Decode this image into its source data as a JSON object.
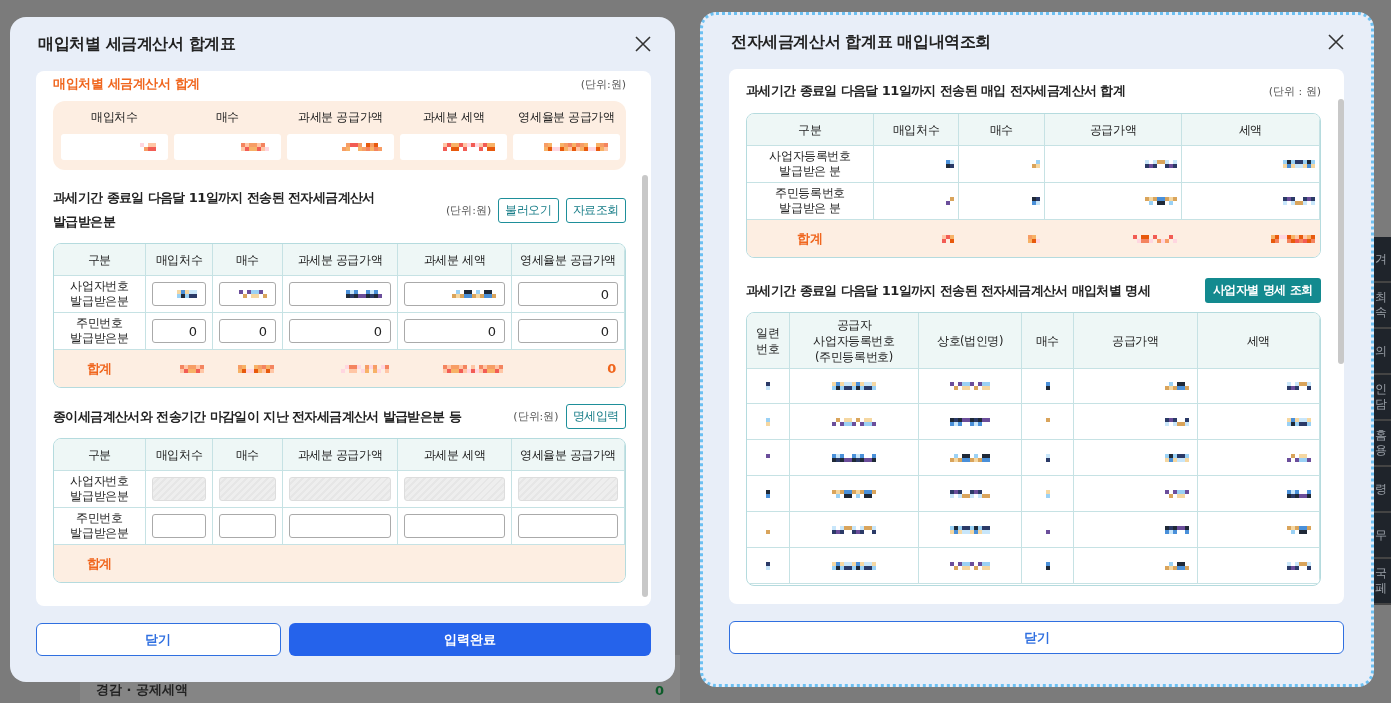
{
  "page": {
    "background_label": "경감 · 공제세액",
    "background_value": "0",
    "side_menu": [
      "겨",
      "최\n속",
      "의",
      "인\n담",
      "홈\n용",
      "령",
      "무",
      "국\n페"
    ]
  },
  "left": {
    "title": "매입처별 세금계산서 합계표",
    "summary": {
      "title": "매입처별 세금계산서 합계",
      "unit": "(단위:원)",
      "columns": [
        "매입처수",
        "매수",
        "과세분 공급가액",
        "과세분 세액",
        "영세율분 공급가액"
      ],
      "values": [
        {
          "redacted": true
        },
        {
          "redacted": true
        },
        {
          "redacted": true
        },
        {
          "redacted": true
        },
        {
          "redacted": true
        }
      ]
    },
    "sections": [
      {
        "title": "과세기간 종료일 다음달 11일까지 전송된 전자세금계산서 발급받은분",
        "unit": "(단위:원)",
        "buttons": [
          "불러오기",
          "자료조회"
        ],
        "columns": [
          "구분",
          "매입처수",
          "매수",
          "과세분 공급가액",
          "과세분 세액",
          "영세율분 공급가액"
        ],
        "rows": [
          {
            "cells": [
              {
                "text": "사업자번호\n발급받은분"
              },
              {
                "redacted": true
              },
              {
                "redacted": true
              },
              {
                "redacted": true
              },
              {
                "redacted": true
              },
              {
                "value": "0"
              }
            ]
          },
          {
            "cells": [
              {
                "text": "주민번호\n발급받은분"
              },
              {
                "value": "0"
              },
              {
                "value": "0"
              },
              {
                "value": "0"
              },
              {
                "value": "0"
              },
              {
                "value": "0"
              }
            ]
          },
          {
            "total": true,
            "cells": [
              {
                "text": "합계"
              },
              {
                "redacted": true
              },
              {
                "redacted": true
              },
              {
                "redacted": true
              },
              {
                "redacted": true
              },
              {
                "value": "0"
              }
            ]
          }
        ]
      },
      {
        "title": "종이세금계산서와 전송기간 마감일이 지난 전자세금계산서 발급받은분 등",
        "unit": "(단위:원)",
        "buttons": [
          "명세입력"
        ],
        "columns": [
          "구분",
          "매입처수",
          "매수",
          "과세분 공급가액",
          "과세분 세액",
          "영세율분 공급가액"
        ],
        "rows": [
          {
            "cells": [
              {
                "text": "사업자번호\n발급받은분"
              },
              {
                "disabled": true
              },
              {
                "disabled": true
              },
              {
                "disabled": true
              },
              {
                "disabled": true
              },
              {
                "disabled": true
              }
            ]
          },
          {
            "cells": [
              {
                "text": "주민번호\n발급받은분"
              },
              {
                "disabled": false
              },
              {
                "disabled": false
              },
              {
                "disabled": false
              },
              {
                "disabled": false
              },
              {
                "disabled": false
              }
            ]
          },
          {
            "total": true,
            "cells": [
              {
                "text": "합계"
              },
              {},
              {},
              {},
              {},
              {}
            ]
          }
        ]
      }
    ],
    "buttons": [
      {
        "label": "닫기",
        "kind": "secondary"
      },
      {
        "label": "입력완료",
        "kind": "primary"
      }
    ]
  },
  "right": {
    "title": "전자세금계산서 합계표 매입내역조회",
    "totals": {
      "title": "과세기간 종료일 다음달 11일까지 전송된 매입 전자세금계산서 합계",
      "unit": "(단위 : 원)",
      "columns": [
        "구분",
        "매입처수",
        "매수",
        "공급가액",
        "세액"
      ],
      "rows": [
        {
          "cells": [
            {
              "text": "사업자등록번호\n발급받은 분"
            },
            {
              "redacted": true
            },
            {
              "redacted": true
            },
            {
              "redacted": true
            },
            {
              "redacted": true
            }
          ]
        },
        {
          "cells": [
            {
              "text": "주민등록번호\n발급받은 분"
            },
            {
              "redacted": true
            },
            {
              "redacted": true
            },
            {
              "redacted": true
            },
            {
              "redacted": true
            }
          ]
        },
        {
          "total": true,
          "cells": [
            {
              "text": "합계"
            },
            {
              "redacted": true
            },
            {
              "redacted": true
            },
            {
              "redacted": true
            },
            {
              "redacted": true
            }
          ]
        }
      ]
    },
    "details": {
      "title": "과세기간 종료일 다음달 11일까지 전송된 전자세금계산서 매입처별 명세",
      "button": "사업자별 명세 조회",
      "columns": [
        "일련\n번호",
        "공급자\n사업자등록번호\n(주민등록번호)",
        "상호(법인명)",
        "매수",
        "공급가액",
        "세액"
      ],
      "rows": [
        {
          "cells": [
            {
              "redacted": true
            },
            {
              "redacted": true
            },
            {
              "redacted": true
            },
            {
              "redacted": true
            },
            {
              "redacted": true
            },
            {
              "redacted": true
            }
          ]
        },
        {
          "cells": [
            {
              "redacted": true
            },
            {
              "redacted": true
            },
            {
              "redacted": true
            },
            {
              "redacted": true
            },
            {
              "redacted": true
            },
            {
              "redacted": true
            }
          ]
        },
        {
          "cells": [
            {
              "redacted": true
            },
            {
              "redacted": true
            },
            {
              "redacted": true
            },
            {
              "redacted": true
            },
            {
              "redacted": true
            },
            {
              "redacted": true
            }
          ]
        },
        {
          "cells": [
            {
              "redacted": true
            },
            {
              "redacted": true
            },
            {
              "redacted": true
            },
            {
              "redacted": true
            },
            {
              "redacted": true
            },
            {
              "redacted": true
            }
          ]
        },
        {
          "cells": [
            {
              "redacted": true
            },
            {
              "redacted": true
            },
            {
              "redacted": true
            },
            {
              "redacted": true
            },
            {
              "redacted": true
            },
            {
              "redacted": true
            }
          ]
        },
        {
          "cells": [
            {
              "redacted": true
            },
            {
              "redacted": true
            },
            {
              "redacted": true
            },
            {
              "redacted": true
            },
            {
              "redacted": true
            },
            {
              "redacted": true
            }
          ]
        }
      ]
    },
    "buttons": [
      {
        "label": "닫기",
        "kind": "secondary"
      }
    ]
  }
}
